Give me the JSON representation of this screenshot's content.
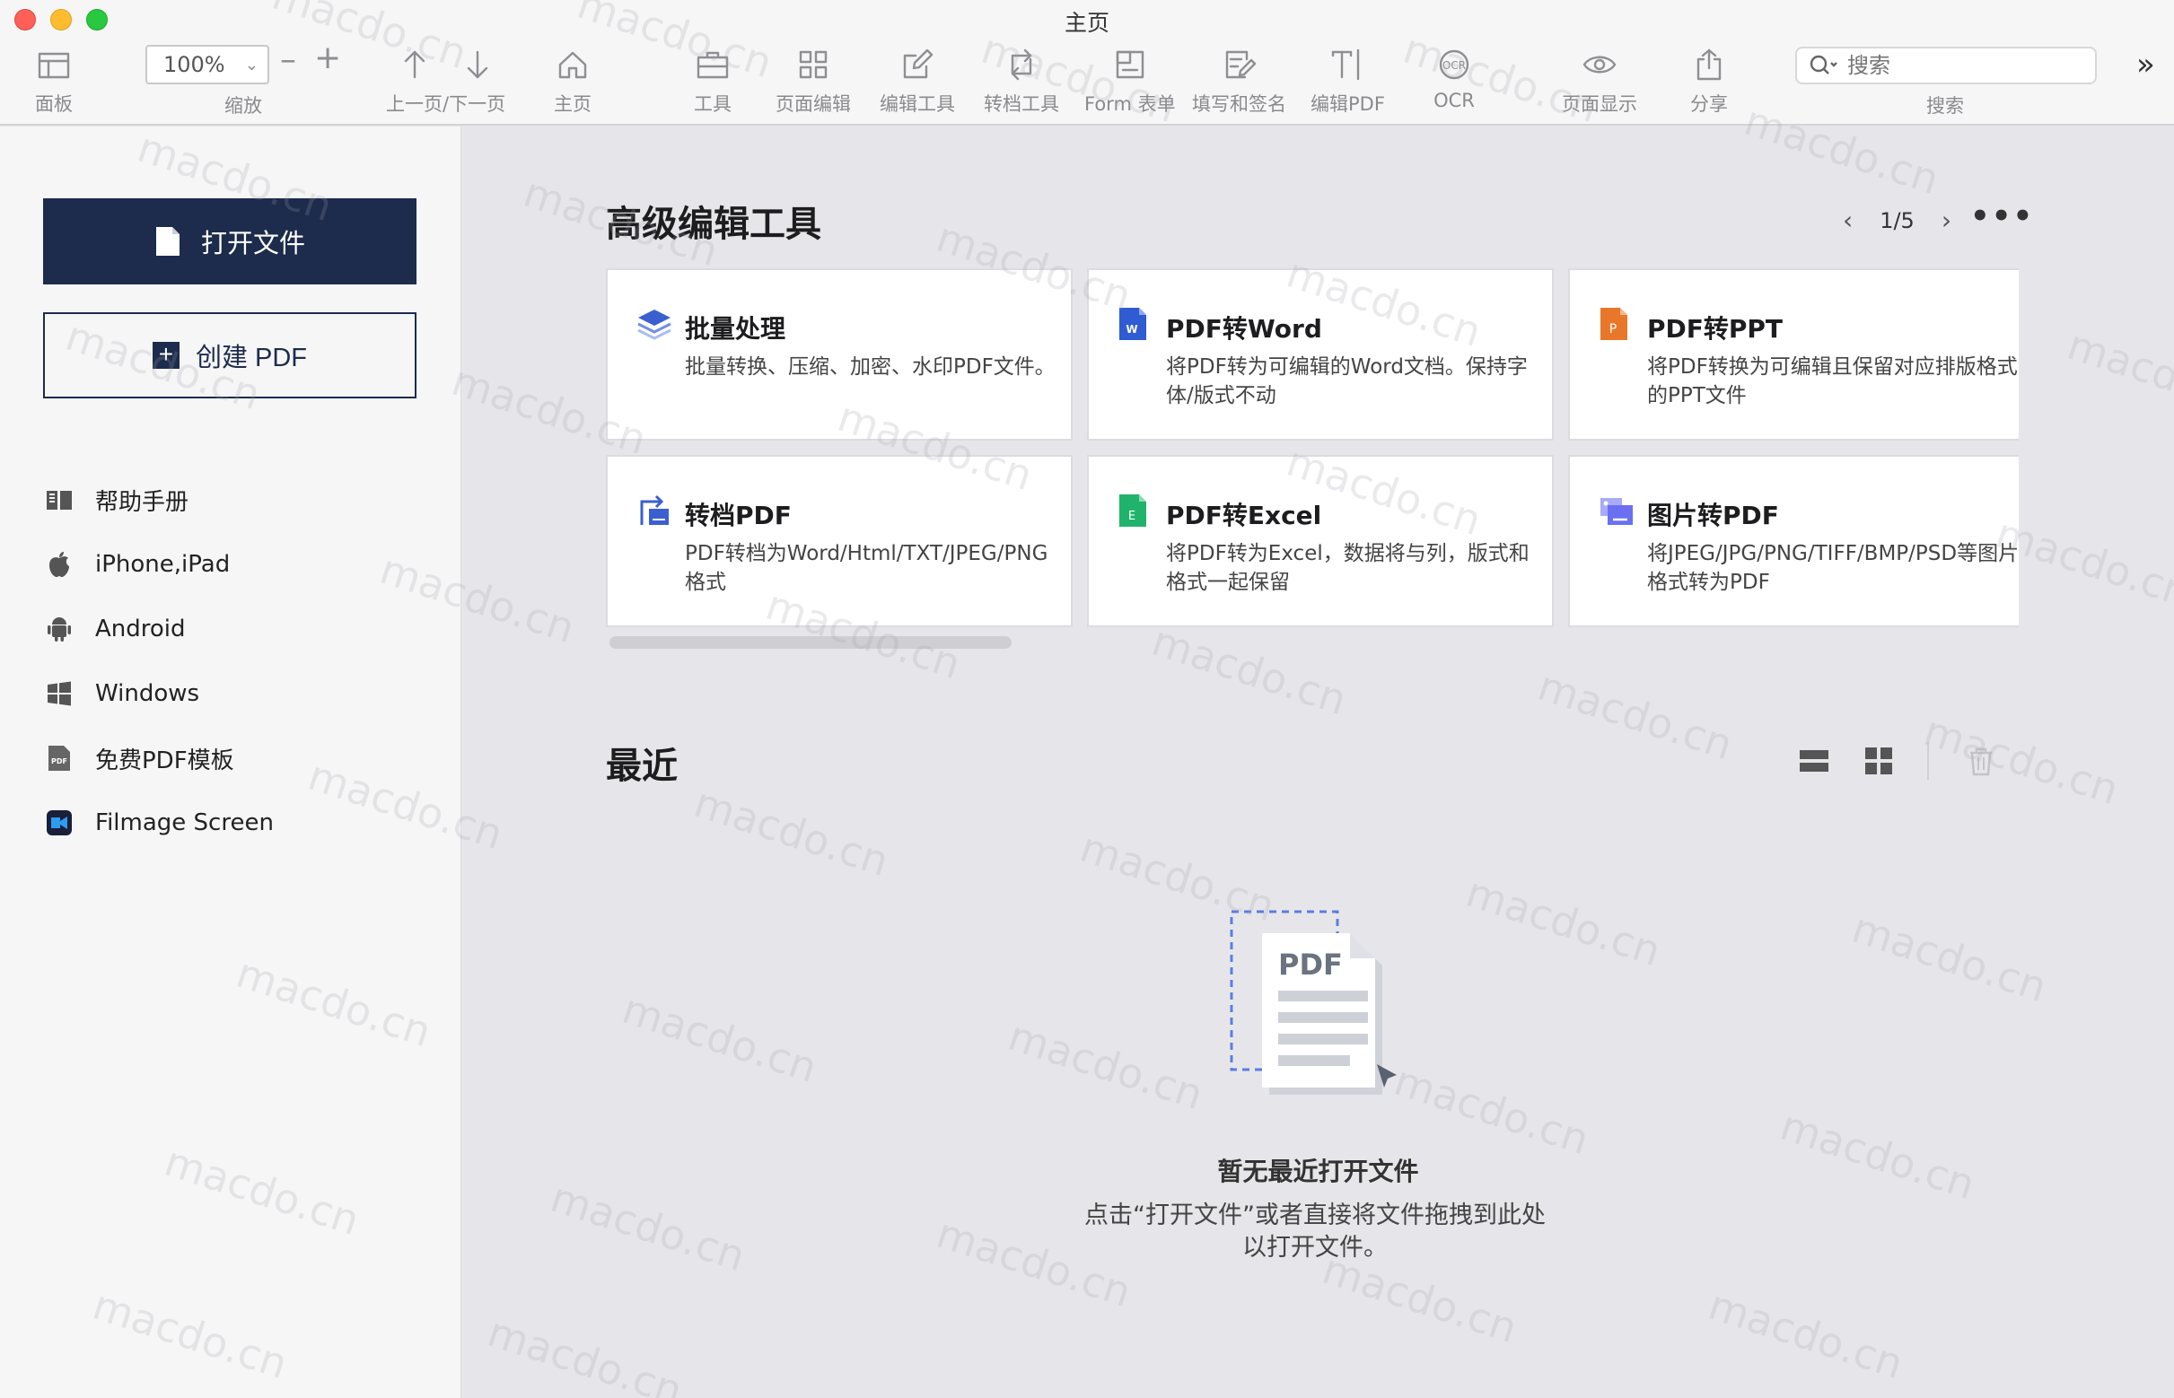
{
  "window": {
    "title": "主页"
  },
  "toolbar": {
    "panel": "面板",
    "zoom_value": "100%",
    "zoom_label": "缩放",
    "zoom_minus": "–",
    "zoom_plus": "+",
    "prev_next": "上一页/下一页",
    "home": "主页",
    "tools": "工具",
    "page_edit": "页面编辑",
    "edit_tools": "编辑工具",
    "convert_tools": "转档工具",
    "form": "Form 表单",
    "fill_sign": "填写和签名",
    "edit_pdf": "编辑PDF",
    "ocr": "OCR",
    "page_display": "页面显示",
    "share": "分享",
    "search_placeholder": "搜索",
    "search_label": "搜索",
    "overflow": "»"
  },
  "sidebar": {
    "open_file": "打开文件",
    "create_pdf": "创建 PDF",
    "items": [
      {
        "label": "帮助手册",
        "icon": "book-icon"
      },
      {
        "label": "iPhone,iPad",
        "icon": "apple-icon"
      },
      {
        "label": "Android",
        "icon": "android-icon"
      },
      {
        "label": "Windows",
        "icon": "windows-icon"
      },
      {
        "label": "免费PDF模板",
        "icon": "pdf-template-icon"
      },
      {
        "label": "Filmage Screen",
        "icon": "filmage-icon"
      }
    ]
  },
  "advanced": {
    "title": "高级编辑工具",
    "page": "1/5",
    "cards": [
      {
        "title": "批量处理",
        "desc": "批量转换、压缩、加密、水印PDF文件。",
        "icon": "layers-icon"
      },
      {
        "title": "PDF转Word",
        "desc": "将PDF转为可编辑的Word文档。保持字体/版式不动",
        "icon": "word-icon"
      },
      {
        "title": "PDF转PPT",
        "desc": "将PDF转换为可编辑且保留对应排版格式的PPT文件",
        "icon": "ppt-icon"
      },
      {
        "title": "转档PDF",
        "desc": "PDF转档为Word/Html/TXT/JPEG/PNG格式",
        "icon": "convert-icon"
      },
      {
        "title": "PDF转Excel",
        "desc": "将PDF转为Excel，数据将与列，版式和格式一起保留",
        "icon": "excel-icon"
      },
      {
        "title": "图片转PDF",
        "desc": "将JPEG/JPG/PNG/TIFF/BMP/PSD等图片格式转为PDF",
        "icon": "image-icon"
      }
    ]
  },
  "recent": {
    "title": "最近",
    "empty_title": "暂无最近打开文件",
    "empty_desc": "点击“打开文件”或者直接将文件拖拽到此处以打开文件。",
    "illus_label": "PDF"
  },
  "watermark": "macdo.cn",
  "colors": {
    "primary": "#1d2b4c",
    "word": "#2f5bd3",
    "ppt": "#e8772a",
    "excel": "#1fb36b",
    "image": "#6b6ff2",
    "layers": "#3a5fd0"
  }
}
